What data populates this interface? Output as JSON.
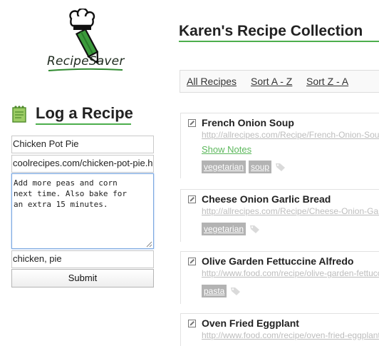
{
  "logo": {
    "text": "RecipeSaver"
  },
  "log": {
    "title": "Log a Recipe",
    "name_value": "Chicken Pot Pie",
    "url_value": "coolrecipes.com/chicken-pot-pie.h",
    "notes_value": "Add more peas and corn\nnext time. Also bake for\nan extra 15 minutes.",
    "tags_value": "chicken, pie",
    "submit_label": "Submit"
  },
  "main": {
    "title": "Karen's Recipe Collection",
    "sort": {
      "all": "All Recipes",
      "az": "Sort A - Z",
      "za": "Sort Z - A"
    },
    "recipes": [
      {
        "title": "French Onion Soup",
        "url": "http://allrecipes.com/Recipe/French-Onion-Soup",
        "show_notes": "Show Notes",
        "tags": [
          "vegetarian",
          "soup"
        ]
      },
      {
        "title": "Cheese Onion Garlic Bread",
        "url": "http://allrecipes.com/Recipe/Cheese-Onion-Garlic",
        "tags": [
          "vegetarian"
        ]
      },
      {
        "title": "Olive Garden Fettuccine Alfredo",
        "url": "http://www.food.com/recipe/olive-garden-fettuccine",
        "tags": [
          "pasta"
        ]
      },
      {
        "title": "Oven Fried Eggplant",
        "url": "http://www.food.com/recipe/oven-fried-eggplant",
        "tags": []
      }
    ]
  },
  "colors": {
    "accent": "#4cae4c",
    "tag_bg": "#b3b3b3",
    "link_muted": "#bdbdbd",
    "show_notes": "#5cb85c"
  },
  "icons": {
    "logo": "chef-hat-pencil-icon",
    "log": "notepad-icon",
    "edit": "edit-icon",
    "tag": "tag-icon"
  }
}
